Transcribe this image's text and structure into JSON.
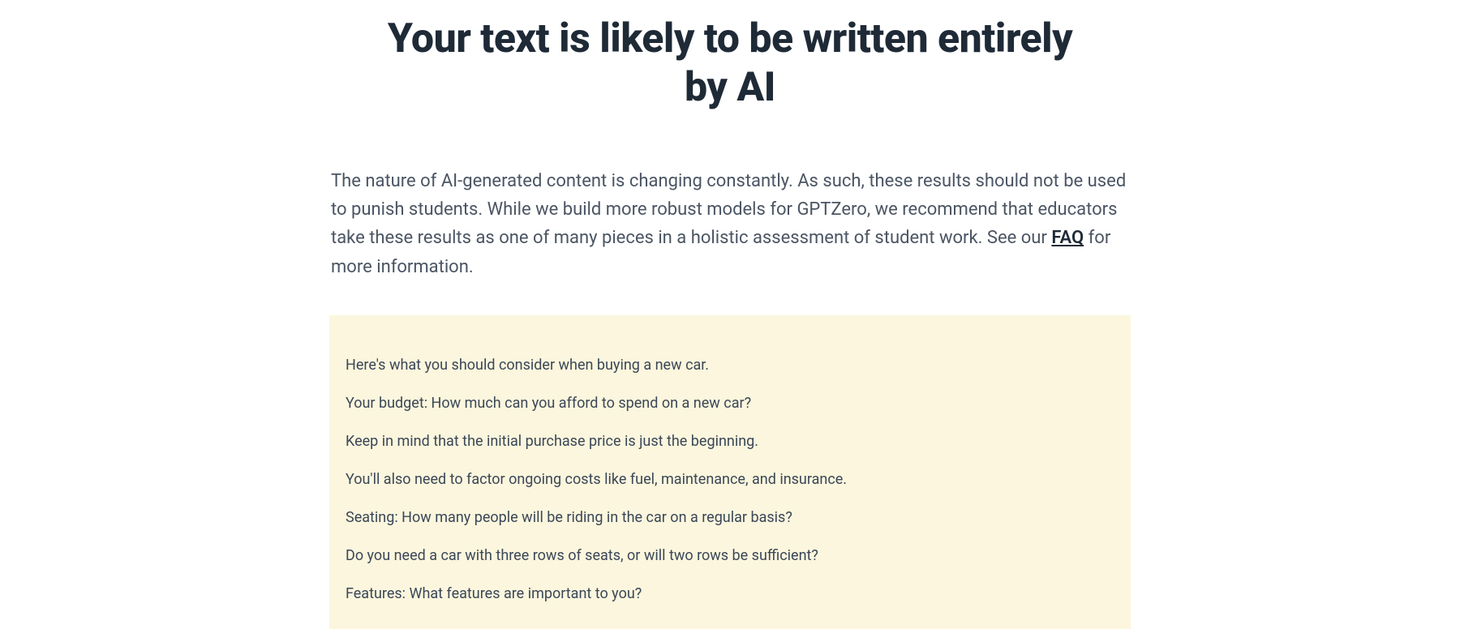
{
  "headline": "Your text is likely to be written entirely by AI",
  "disclaimer": {
    "pre": "The nature of AI-generated content is changing constantly. As such, these results should not be used to punish students. While we build more robust models for GPTZero, we recommend that educators take these results as one of many pieces in a holistic assessment of student work. See our ",
    "link": "FAQ",
    "post": " for more information."
  },
  "analysis": {
    "lines": [
      "Here's what you should consider when buying a new car.",
      "Your budget: How much can you afford to spend on a new car?",
      "Keep in mind that the initial purchase price is just the beginning.",
      "You'll also need to factor ongoing costs like fuel, maintenance, and insurance.",
      "Seating: How many people will be riding in the car on a regular basis?",
      "Do you need a car with three rows of seats, or will two rows be sufficient?",
      "Features: What features are important to you?"
    ]
  }
}
